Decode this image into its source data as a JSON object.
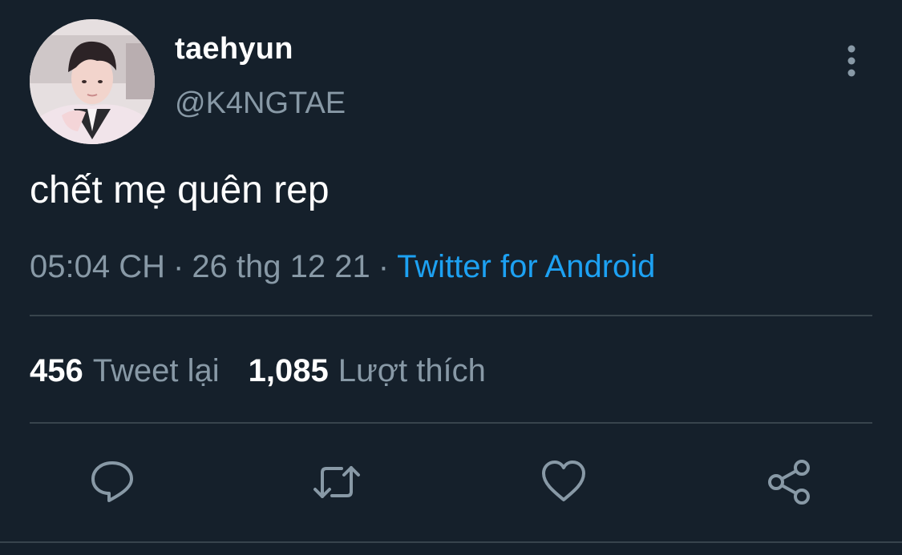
{
  "author": {
    "display_name": "taehyun",
    "handle": "@K4NGTAE"
  },
  "tweet": {
    "text": "chết mẹ quên rep"
  },
  "meta": {
    "time": "05:04 CH",
    "date": "26 thg 12 21",
    "separator": "·",
    "source": "Twitter for Android"
  },
  "stats": {
    "retweets_count": "456",
    "retweets_label": "Tweet lại",
    "likes_count": "1,085",
    "likes_label": "Lượt thích"
  },
  "icons": {
    "more": "more-vertical-icon",
    "reply": "reply-icon",
    "retweet": "retweet-icon",
    "like": "heart-icon",
    "share": "share-icon"
  },
  "colors": {
    "background": "#15202b",
    "accent": "#1da1f2",
    "secondary_text": "#8899a6",
    "divider": "#38444d",
    "icon": "#8899a6"
  }
}
